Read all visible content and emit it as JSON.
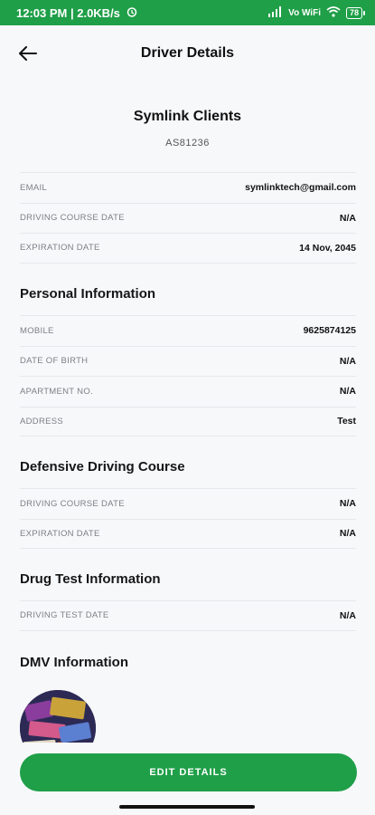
{
  "status_bar": {
    "time_speed": "12:03 PM | 2.0KB/s",
    "network_label": "Vo WiFi",
    "battery": "78"
  },
  "header": {
    "title": "Driver Details"
  },
  "profile": {
    "name": "Symlink Clients",
    "code": "AS81236"
  },
  "details": [
    {
      "label": "EMAIL",
      "value": "symlinktech@gmail.com"
    },
    {
      "label": "DRIVING COURSE DATE",
      "value": "N/A"
    },
    {
      "label": "EXPIRATION DATE",
      "value": "14 Nov, 2045"
    }
  ],
  "personal": {
    "title": "Personal Information",
    "rows": [
      {
        "label": "MOBILE",
        "value": "9625874125"
      },
      {
        "label": "DATE OF BIRTH",
        "value": "N/A"
      },
      {
        "label": "APARTMENT NO.",
        "value": "N/A"
      },
      {
        "label": "ADDRESS",
        "value": "Test"
      }
    ]
  },
  "defensive": {
    "title": "Defensive Driving Course",
    "rows": [
      {
        "label": "DRIVING COURSE DATE",
        "value": "N/A"
      },
      {
        "label": "EXPIRATION DATE",
        "value": "N/A"
      }
    ]
  },
  "drug_test": {
    "title": "Drug Test Information",
    "rows": [
      {
        "label": "DRIVING TEST DATE",
        "value": "N/A"
      }
    ]
  },
  "dmv": {
    "title": "DMV Information"
  },
  "actions": {
    "edit_label": "EDIT DETAILS"
  },
  "colors": {
    "accent": "#1f9f48",
    "background": "#f7f8fa"
  }
}
